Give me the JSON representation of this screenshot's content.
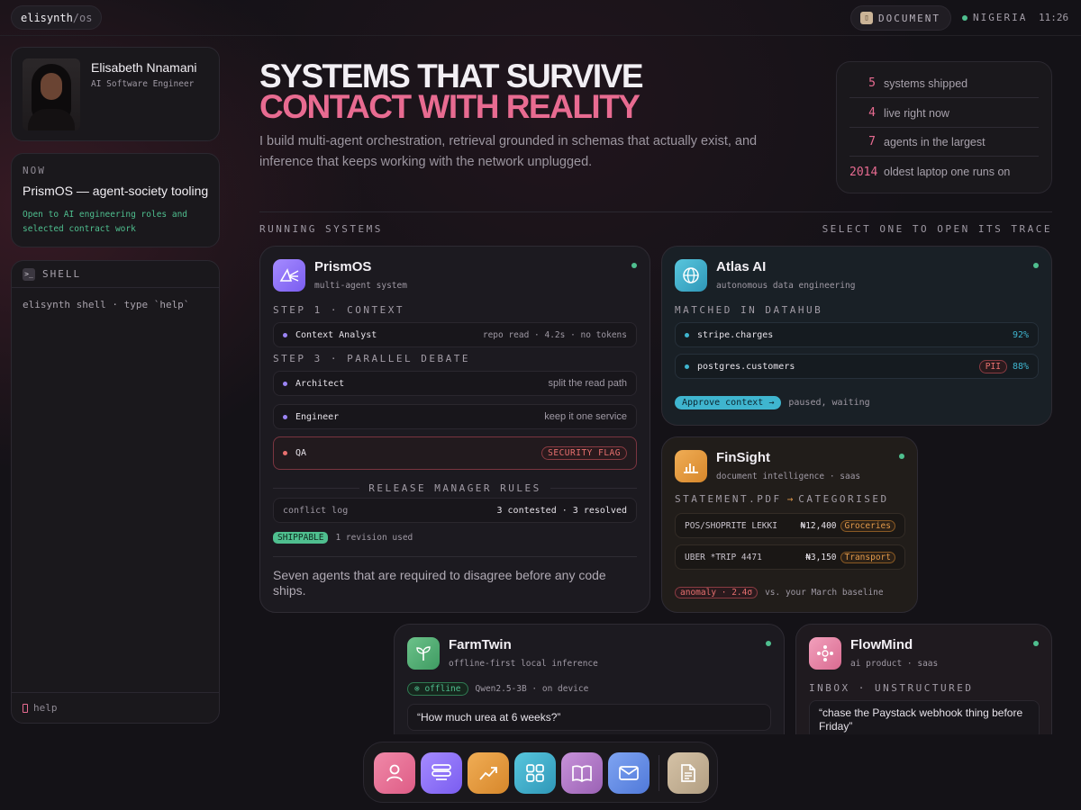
{
  "topbar": {
    "brand_main": "elisynth",
    "brand_sub": "/os",
    "doc_label": "DOCUMENT",
    "location": "NIGERIA",
    "time": "11:26"
  },
  "profile": {
    "name": "Elisabeth Nnamani",
    "role": "AI Software Engineer"
  },
  "now": {
    "label": "NOW",
    "title": "PrismOS — agent-society tooling",
    "sub": "Open to AI engineering roles and selected contract work"
  },
  "shell": {
    "title": "SHELL",
    "line": "elisynth shell · type `help`",
    "footer": "help"
  },
  "hero": {
    "line1": "SYSTEMS THAT SURVIVE",
    "line2": "CONTACT WITH REALITY",
    "lead": "I build multi-agent orchestration, retrieval grounded in schemas that actually exist, and inference that keeps working with the network unplugged."
  },
  "stats": [
    {
      "n": "5",
      "t": "systems shipped"
    },
    {
      "n": "4",
      "t": "live right now"
    },
    {
      "n": "7",
      "t": "agents in the largest"
    },
    {
      "n": "2014",
      "t": "oldest laptop one runs on"
    }
  ],
  "section": {
    "left": "RUNNING SYSTEMS",
    "right": "SELECT ONE TO OPEN ITS TRACE"
  },
  "prism": {
    "title": "PrismOS",
    "sub": "multi-agent system",
    "step1": "STEP 1 · CONTEXT",
    "ctx_name": "Context Analyst",
    "ctx_meta": "repo read · 4.2s · no tokens",
    "step3": "STEP 3 · PARALLEL DEBATE",
    "arch_name": "Architect",
    "arch_meta": "split the read path",
    "eng_name": "Engineer",
    "eng_meta": "keep it one service",
    "qa_name": "QA",
    "qa_flag": "SECURITY FLAG",
    "rules": "RELEASE MANAGER RULES",
    "conflict_label": "conflict log",
    "conflict_value": "3 contested · 3 resolved",
    "shippable": "SHIPPABLE",
    "revision": "1 revision used",
    "desc": "Seven agents that are required to disagree before any code ships."
  },
  "atlas": {
    "title": "Atlas AI",
    "sub": "autonomous data engineering",
    "matched": "MATCHED IN DATAHUB",
    "r1_name": "stripe.charges",
    "r1_pct": "92%",
    "r2_name": "postgres.customers",
    "r2_tag": "PII",
    "r2_pct": "88%",
    "approve": "Approve context →",
    "status": "paused, waiting"
  },
  "fin": {
    "title": "FinSight",
    "sub": "document intelligence · saas",
    "flow_a": "STATEMENT.PDF",
    "flow_arrow": "→",
    "flow_b": "CATEGORISED",
    "r1_name": "POS/SHOPRITE LEKKI",
    "r1_amt": "₦12,400",
    "r1_tag": "Groceries",
    "r2_name": "UBER *TRIP 4471",
    "r2_amt": "₦3,150",
    "r2_tag": "Transport",
    "anomaly": "anomaly · 2.4σ",
    "baseline": "vs. your March baseline"
  },
  "farm": {
    "title": "FarmTwin",
    "sub": "offline-first local inference",
    "offline": "offline",
    "model": "Qwen2.5-3B · on device",
    "question": "“How much urea at 6 weeks?”"
  },
  "flow": {
    "title": "FlowMind",
    "sub": "ai product · saas",
    "inbox": "INBOX · UNSTRUCTURED",
    "message": "“chase the Paystack webhook thing before Friday”"
  },
  "colors": {
    "accent_pink": "#e86b91",
    "live_green": "#4fbf8f",
    "teal": "#3fb5cf",
    "orange": "#e39a4a"
  },
  "dock": [
    "profile-icon",
    "systems-icon",
    "growth-icon",
    "apps-icon",
    "book-icon",
    "mail-icon",
    "document-icon"
  ]
}
